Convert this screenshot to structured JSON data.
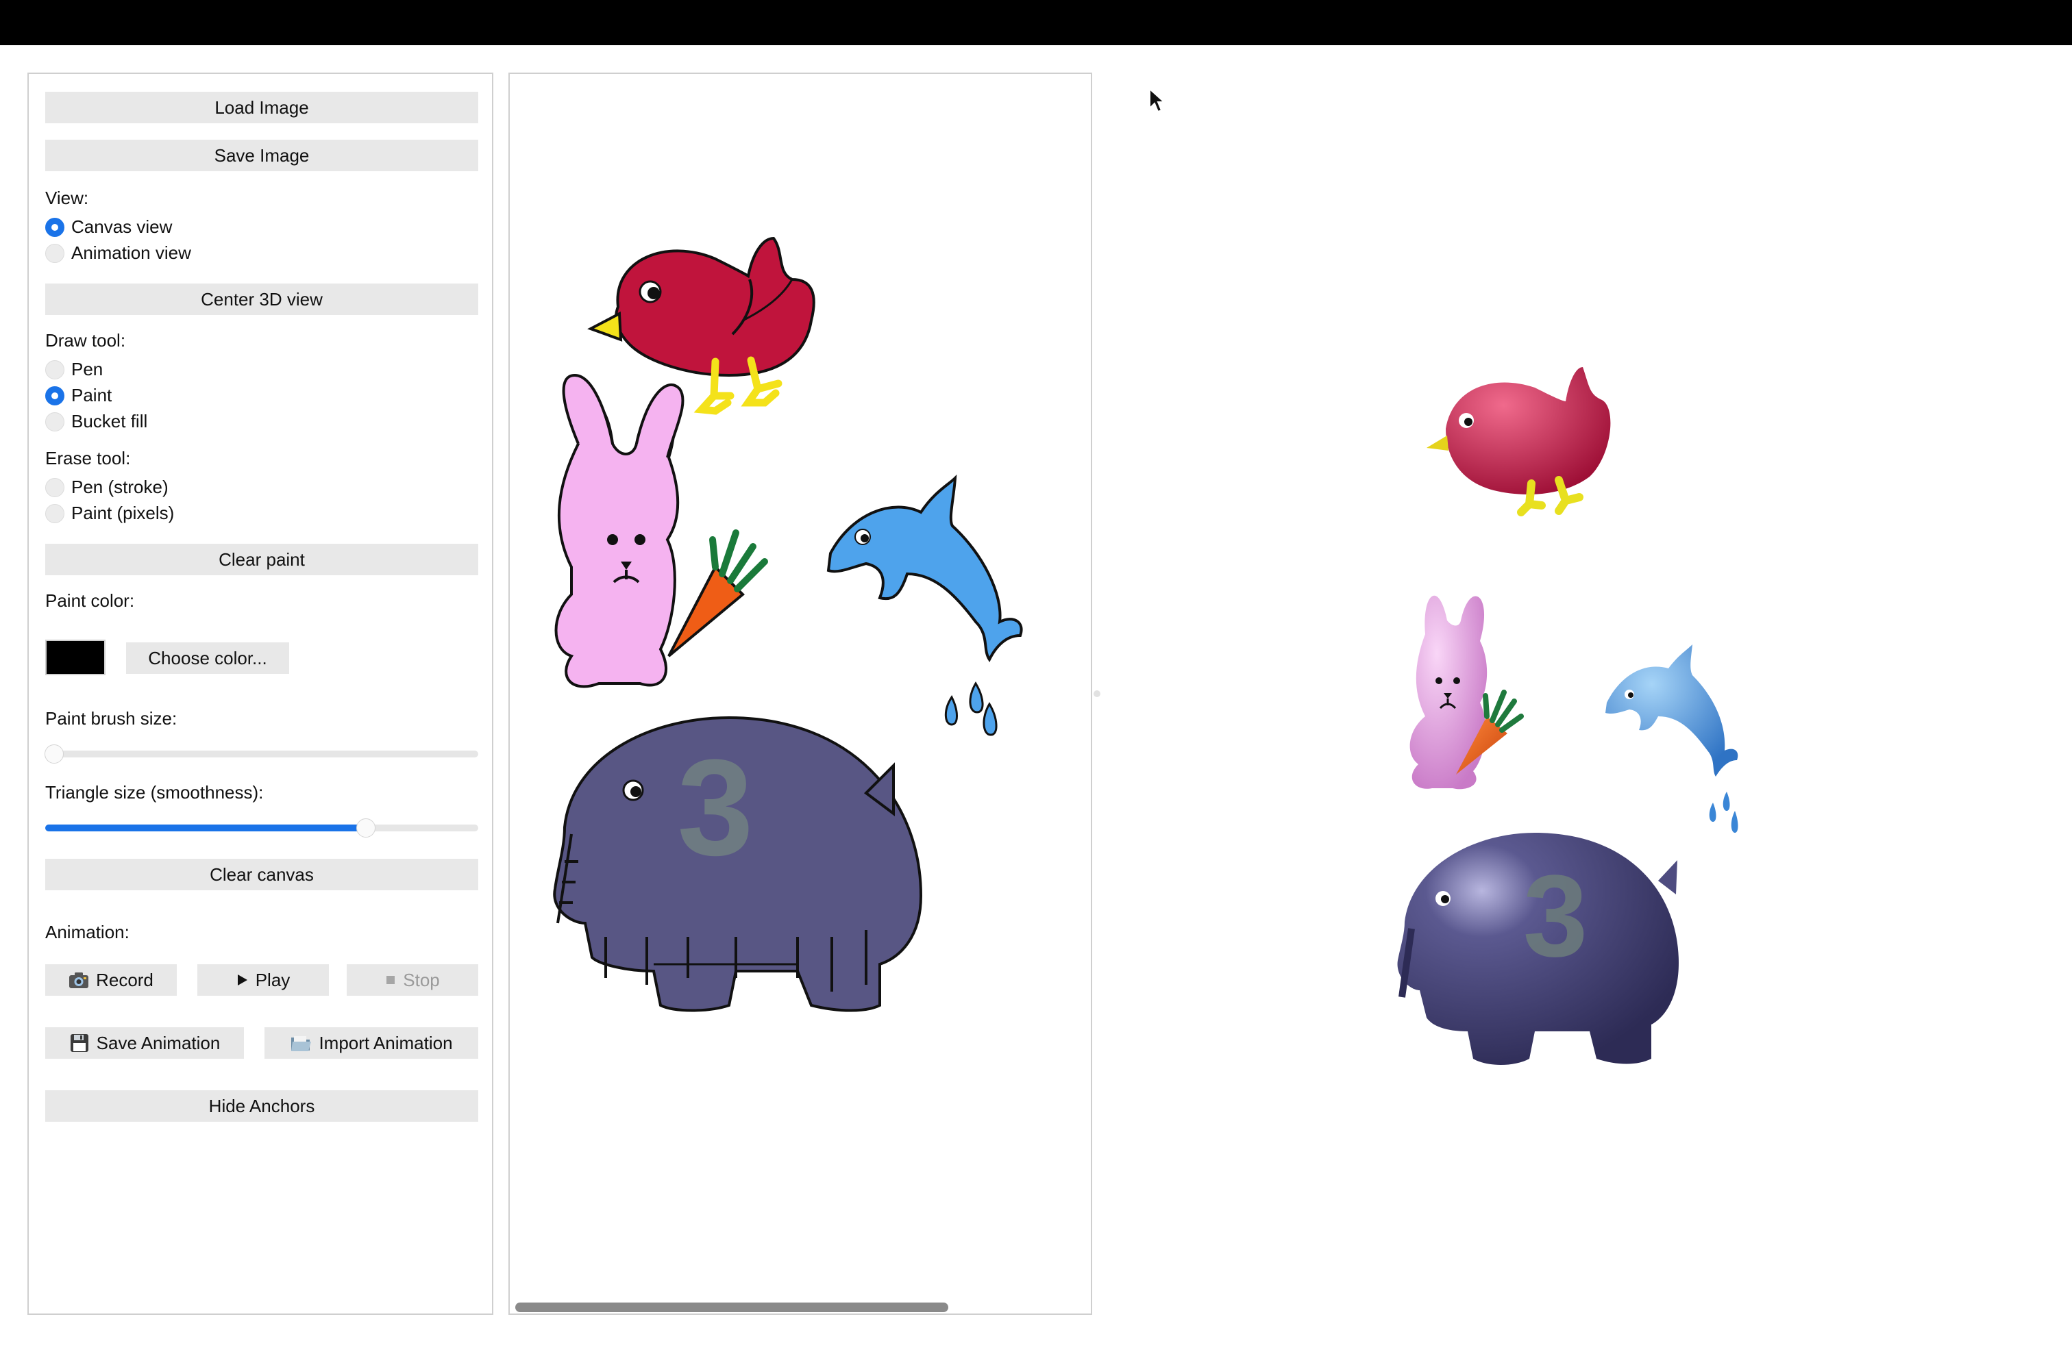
{
  "buttons": {
    "load_image": "Load Image",
    "save_image": "Save Image",
    "center_view": "Center 3D view",
    "clear_paint": "Clear paint",
    "choose_color": "Choose color...",
    "clear_canvas": "Clear canvas",
    "record": "Record",
    "play": "Play",
    "stop": "Stop",
    "save_animation": "Save Animation",
    "import_animation": "Import Animation",
    "hide_anchors": "Hide Anchors"
  },
  "view": {
    "label": "View:",
    "options": [
      {
        "label": "Canvas view",
        "checked": true
      },
      {
        "label": "Animation view",
        "checked": false
      }
    ]
  },
  "draw_tool": {
    "label": "Draw tool:",
    "options": [
      {
        "label": "Pen",
        "checked": false
      },
      {
        "label": "Paint",
        "checked": true
      },
      {
        "label": "Bucket fill",
        "checked": false
      }
    ]
  },
  "erase_tool": {
    "label": "Erase tool:",
    "options": [
      {
        "label": "Pen (stroke)",
        "checked": false
      },
      {
        "label": "Paint (pixels)",
        "checked": false
      }
    ]
  },
  "paint_color": {
    "label": "Paint color:",
    "value": "#000000"
  },
  "brush_size": {
    "label": "Paint brush size:",
    "fraction": 0.02
  },
  "triangle_size": {
    "label": "Triangle size (smoothness):",
    "fraction": 0.74
  },
  "animation": {
    "label": "Animation:"
  },
  "icons": {
    "record": "camera-icon",
    "play": "play-icon",
    "stop": "stop-icon",
    "save_animation": "floppy-disk-icon",
    "import_animation": "folder-icon"
  },
  "drawing": {
    "elephant_number": "3",
    "colors": {
      "bird": "#c0143c",
      "bird_beak": "#f4e21a",
      "rabbit": "#f5b3f0",
      "carrot": "#ef5d16",
      "carrot_top": "#1a7a3a",
      "dolphin": "#4ea3ec",
      "elephant": "#585684",
      "elephant_number": "#6d7a82"
    }
  },
  "accent_color": "#1a73e8"
}
